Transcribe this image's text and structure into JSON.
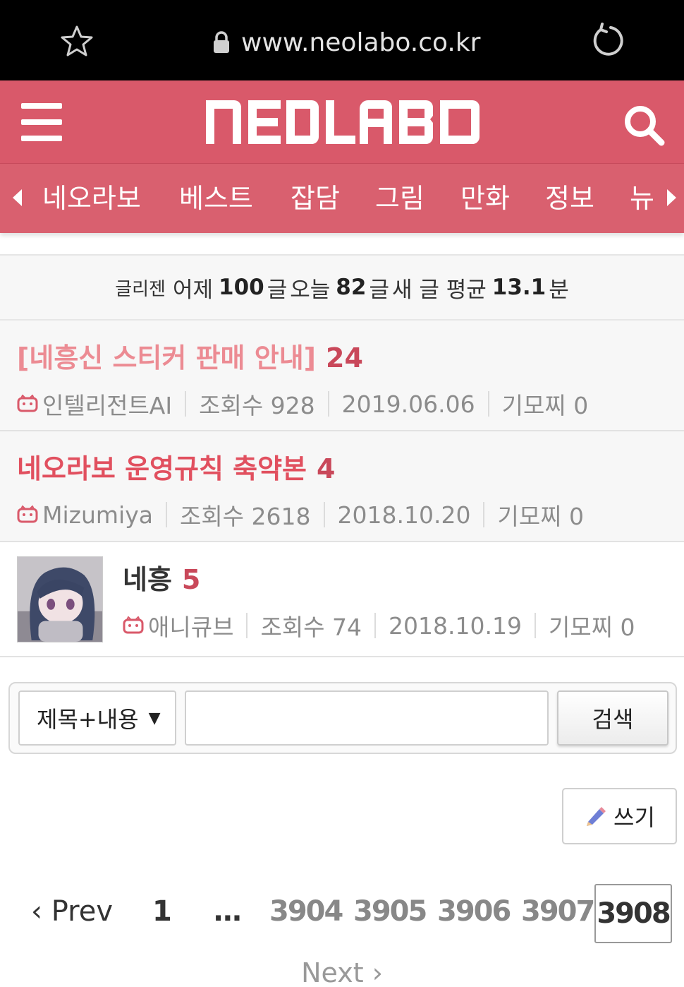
{
  "browser": {
    "url": "www.neolabo.co.kr",
    "icons": [
      "star-icon",
      "lock-icon",
      "reload-icon"
    ]
  },
  "header": {
    "logo": "NEOLABO",
    "brand_color": "#d9596a",
    "icons": [
      "menu-icon",
      "search-icon"
    ]
  },
  "nav": {
    "items": [
      "네오라보",
      "베스트",
      "잡담",
      "그림",
      "만화",
      "정보",
      "뉴"
    ]
  },
  "stats": {
    "label": "글리젠",
    "yesterday_label": "어제",
    "yesterday_count": "100",
    "unit": "글",
    "today_label": "오늘",
    "today_count": "82",
    "avg_label": "새 글 평균",
    "avg_value": "13.1",
    "avg_unit": "분"
  },
  "posts": [
    {
      "title": "[네흥신 스티커 판매 안내]",
      "comments": "24",
      "author": "인텔리전트AI",
      "views": "조회수 928",
      "date": "2019.06.06",
      "likes": "기모찌 0"
    },
    {
      "title": "네오라보 운영규칙 축약본",
      "comments": "4",
      "author": "Mizumiya",
      "views": "조회수 2618",
      "date": "2018.10.20",
      "likes": "기모찌 0"
    },
    {
      "title": "네흥",
      "comments": "5",
      "author": "애니큐브",
      "views": "조회수 74",
      "date": "2018.10.19",
      "likes": "기모찌 0"
    }
  ],
  "search": {
    "scope": "제목+내용",
    "query": "",
    "button": "검색"
  },
  "write_button": "쓰기",
  "pagination": {
    "prev": "Prev",
    "first": "1",
    "ellipsis": "...",
    "pages": [
      "3904",
      "3905",
      "3906",
      "3907"
    ],
    "current": "3908",
    "next": "Next"
  }
}
